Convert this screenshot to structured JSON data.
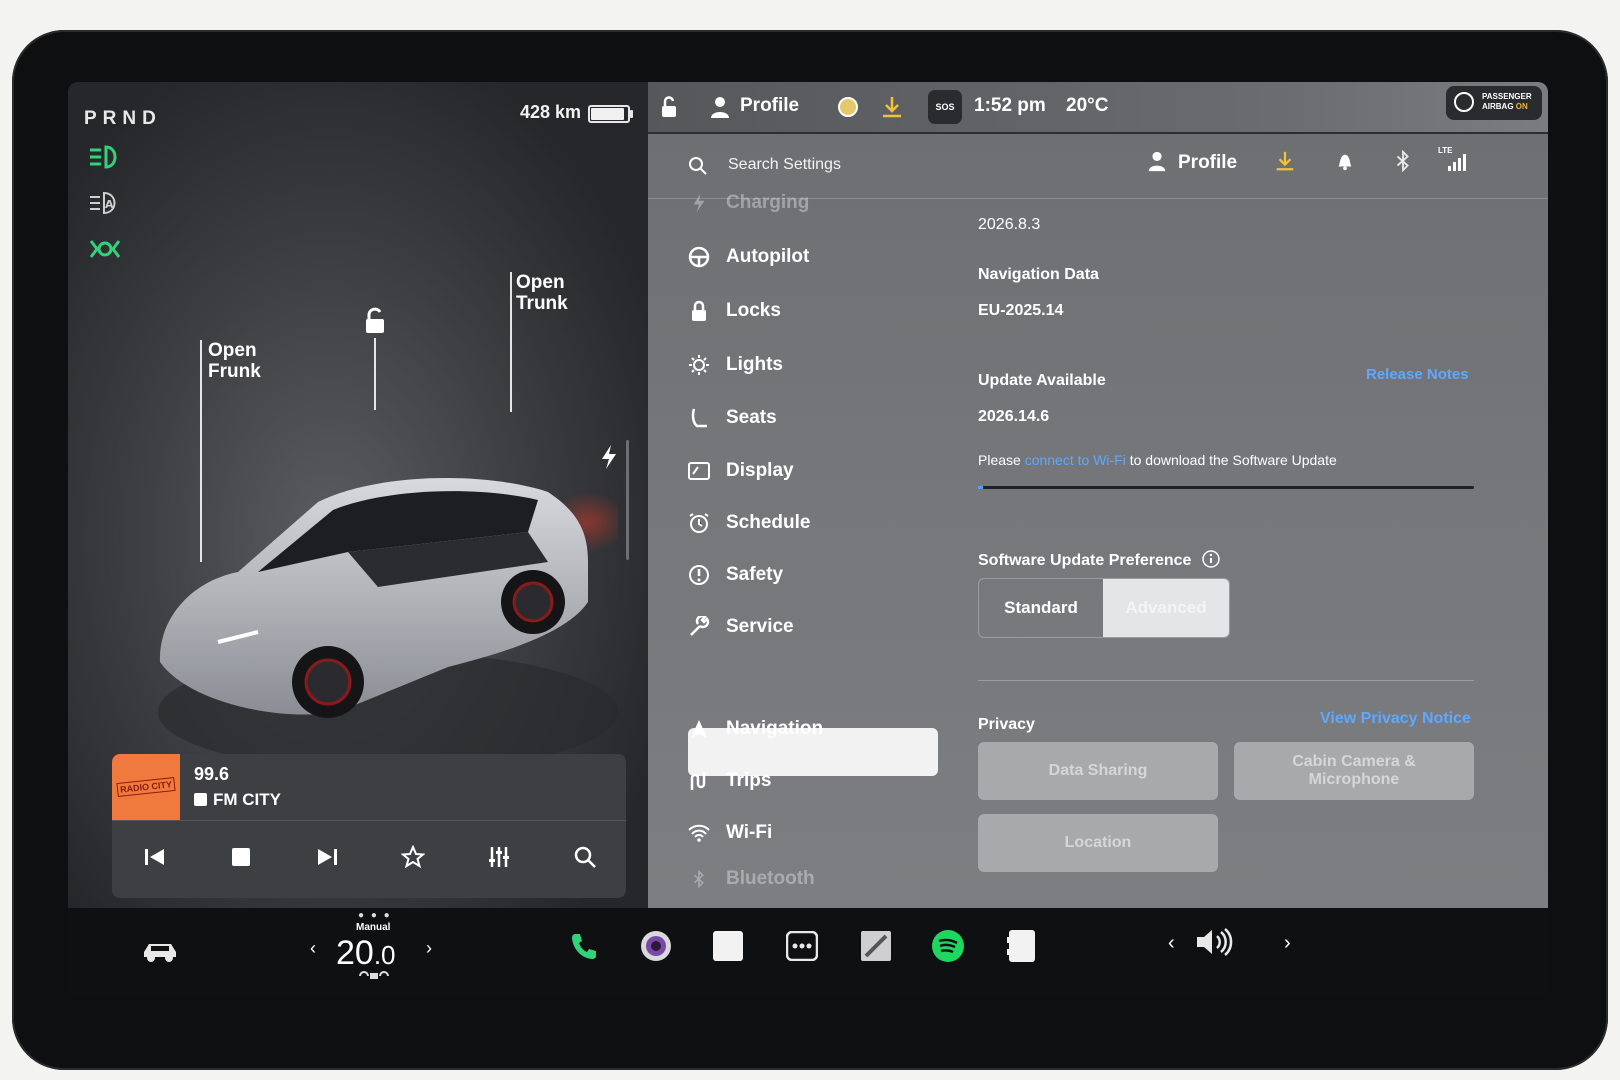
{
  "drive": {
    "gear_selector": "PRND",
    "range": "428 km",
    "battery_level": 0.88
  },
  "car_view": {
    "frunk_label_1": "Open",
    "frunk_label_2": "Frunk",
    "trunk_label_1": "Open",
    "trunk_label_2": "Trunk"
  },
  "media": {
    "frequency": "99.6",
    "station": "FM CITY",
    "logo_text": "RADIO CITY"
  },
  "status_bar": {
    "profile": "Profile",
    "time": "1:52 pm",
    "temperature": "20°C",
    "sos": "SOS",
    "airbag_line1": "PASSENGER",
    "airbag_line2": "AIRBAG",
    "airbag_state": "ON"
  },
  "settings": {
    "search_placeholder": "Search Settings",
    "profile": "Profile",
    "network": "LTE",
    "menu": [
      {
        "label": "Charging",
        "icon": "charging-icon"
      },
      {
        "label": "Autopilot",
        "icon": "steering-wheel-icon"
      },
      {
        "label": "Locks",
        "icon": "lock-icon"
      },
      {
        "label": "Lights",
        "icon": "light-bulb-icon"
      },
      {
        "label": "Seats",
        "icon": "seat-icon"
      },
      {
        "label": "Display",
        "icon": "display-icon"
      },
      {
        "label": "Schedule",
        "icon": "alarm-clock-icon"
      },
      {
        "label": "Safety",
        "icon": "safety-icon"
      },
      {
        "label": "Service",
        "icon": "wrench-icon"
      },
      {
        "label": "Navigation",
        "icon": "navigation-icon"
      },
      {
        "label": "Trips",
        "icon": "trips-icon"
      },
      {
        "label": "Wi-Fi",
        "icon": "wifi-icon"
      },
      {
        "label": "Bluetooth",
        "icon": "bluetooth-icon"
      }
    ],
    "software": {
      "current_version": "2026.8.3",
      "nav_data_label": "Navigation Data",
      "nav_data_value": "EU-2025.14",
      "update_label": "Update Available",
      "update_version": "2026.14.6",
      "release_notes": "Release Notes",
      "msg_prefix": "Please",
      "msg_link": "connect to Wi-Fi",
      "msg_suffix": "to download the Software Update",
      "download_progress": 0.01,
      "pref_label": "Software Update Preference",
      "pref_options": [
        "Standard",
        "Advanced"
      ],
      "pref_selected": "Advanced"
    },
    "privacy": {
      "label": "Privacy",
      "notice_link": "View Privacy Notice",
      "data_sharing": "Data Sharing",
      "cabin_camera_1": "Cabin Camera &",
      "cabin_camera_2": "Microphone",
      "location": "Location"
    }
  },
  "taskbar": {
    "climate_mode": "Manual",
    "temp_whole": "20",
    "temp_decimal": ".0"
  },
  "colors": {
    "accent_green": "#33d17a",
    "link_blue": "#5ea8ff",
    "download_yellow": "#f0c23a",
    "spotify_green": "#1ed760"
  }
}
